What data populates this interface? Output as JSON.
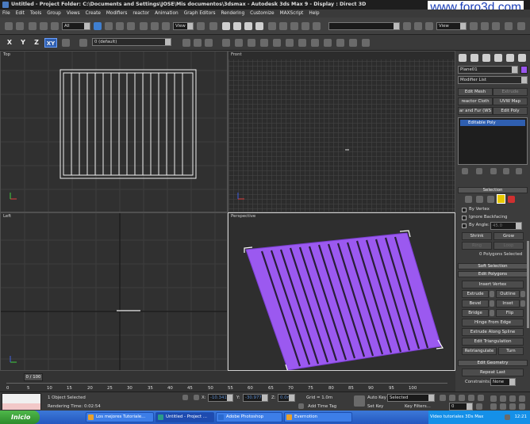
{
  "titlebar": {
    "app_name": "Untitled",
    "text": "Untitled     - Project Folder: C:\\Documents and Settings\\JOSE\\Mis documentos\\3dsmax     - Autodesk 3ds Max 9     - Display : Direct 3D",
    "watermark": "www.foro3d.com"
  },
  "menu": [
    "File",
    "Edit",
    "Tools",
    "Group",
    "Views",
    "Create",
    "Modifiers",
    "reactor",
    "Animation",
    "Graph Editors",
    "Rendering",
    "Customize",
    "MAXScript",
    "Help"
  ],
  "toolbar": {
    "selection_filter": "All",
    "ref_coord": "View",
    "ref_coord_2": "View",
    "named_selection": "",
    "axes": [
      "X",
      "Y",
      "Z",
      "XY"
    ],
    "active_axis": "XY",
    "layer": "0 (default)"
  },
  "viewports": {
    "top": "Top",
    "front": "Front",
    "left": "Left",
    "perspective": "Perspective"
  },
  "command_panel": {
    "object_name": "Plane01",
    "object_color": "#9955ee",
    "modifier_list": "Modifier List",
    "buttons": [
      "Edit Mesh",
      "Extrude",
      "reactor Cloth",
      "UVW Map",
      "ar and Fur (WS",
      "Edit Poly"
    ],
    "stack_item": "Editable Poly",
    "selection": {
      "title": "Selection",
      "by_vertex": "By Vertex",
      "ignore_backfacing": "Ignore Backfacing",
      "by_angle": "By Angle:",
      "angle_value": "45.0",
      "shrink": "Shrink",
      "grow": "Grow",
      "ring": "Ring",
      "loop": "Loop",
      "status": "0 Polygons Selected"
    },
    "soft_selection": "Soft Selection",
    "edit_polygons": {
      "title": "Edit Polygons",
      "insert_vertex": "Insert Vertex",
      "extrude": "Extrude",
      "outline": "Outline",
      "bevel": "Bevel",
      "inset": "Inset",
      "bridge": "Bridge",
      "flip": "Flip",
      "hinge": "Hinge From Edge",
      "extrude_spline": "Extrude Along Spline",
      "edit_triangulation": "Edit Triangulation",
      "retriangulate": "Retriangulate",
      "turn": "Turn"
    },
    "edit_geometry": {
      "title": "Edit Geometry",
      "repeat_last": "Repeat Last",
      "constraints": "Constraints:",
      "constraints_value": "None"
    }
  },
  "timeline": {
    "slider": "0 / 100",
    "ticks": [
      "0",
      "5",
      "10",
      "15",
      "20",
      "25",
      "30",
      "35",
      "40",
      "45",
      "50",
      "55",
      "60",
      "65",
      "70",
      "75",
      "80",
      "85",
      "90",
      "95",
      "100"
    ]
  },
  "status": {
    "selected": "1 Object Selected",
    "render_time": "Rendering Time: 0:02:54",
    "x_label": "X:",
    "x_value": "-10.341m",
    "y_label": "Y:",
    "y_value": "-30.977m",
    "z_label": "Z:",
    "z_value": "0.0m",
    "grid": "Grid = 1.0m",
    "add_time_tag": "Add Time Tag",
    "auto_key": "Auto Key",
    "set_key": "Set Key",
    "selected_dd": "Selected",
    "key_filters": "Key Filters...",
    "frame": "0"
  },
  "taskbar": {
    "start": "Inicio",
    "tasks": [
      "Los mejores Tutoriale...",
      "Untitled     - Project ...",
      "Adobe Photoshop",
      "Evernotion"
    ],
    "tray_text": "Video tutoriales 3Ds Max",
    "clock": "12:21"
  },
  "colors": {
    "plane": "#9b59f0",
    "accent": "#2f5fb0"
  }
}
